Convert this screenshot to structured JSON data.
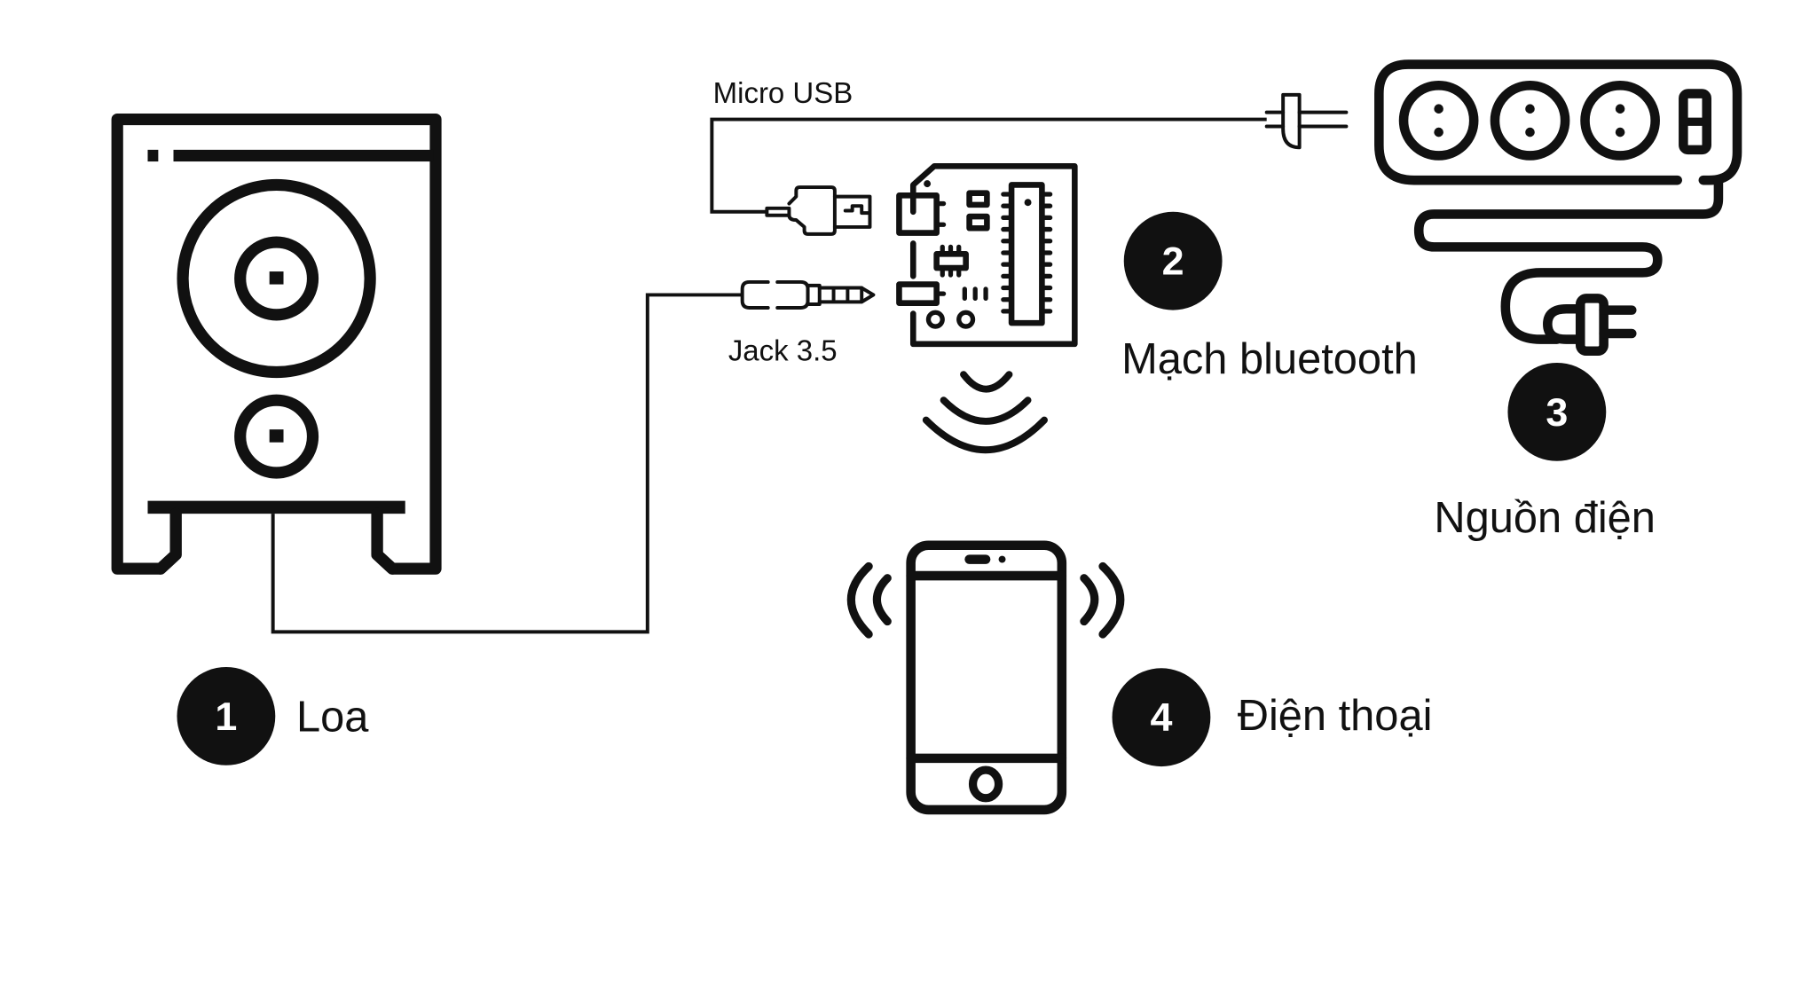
{
  "diagram": {
    "type": "bluetooth-speaker-wiring",
    "colors": {
      "line": "#111111",
      "signal": "#0f1d33",
      "background": "#ffffff"
    },
    "components": [
      {
        "number": "1",
        "label": "Loa",
        "icon": "speaker-icon"
      },
      {
        "number": "2",
        "label": "Mạch bluetooth",
        "icon": "bluetooth-board-icon"
      },
      {
        "number": "3",
        "label": "Nguồn điện",
        "icon": "power-strip-icon"
      },
      {
        "number": "4",
        "label": "Điện thoại",
        "icon": "smartphone-icon"
      }
    ],
    "connectors": [
      {
        "label": "Micro USB",
        "icon": "micro-usb-plug-icon",
        "from": "Nguồn điện",
        "to": "Mạch bluetooth"
      },
      {
        "label": "Jack 3.5",
        "icon": "audio-jack-icon",
        "from": "Mạch bluetooth",
        "to": "Loa"
      }
    ]
  }
}
